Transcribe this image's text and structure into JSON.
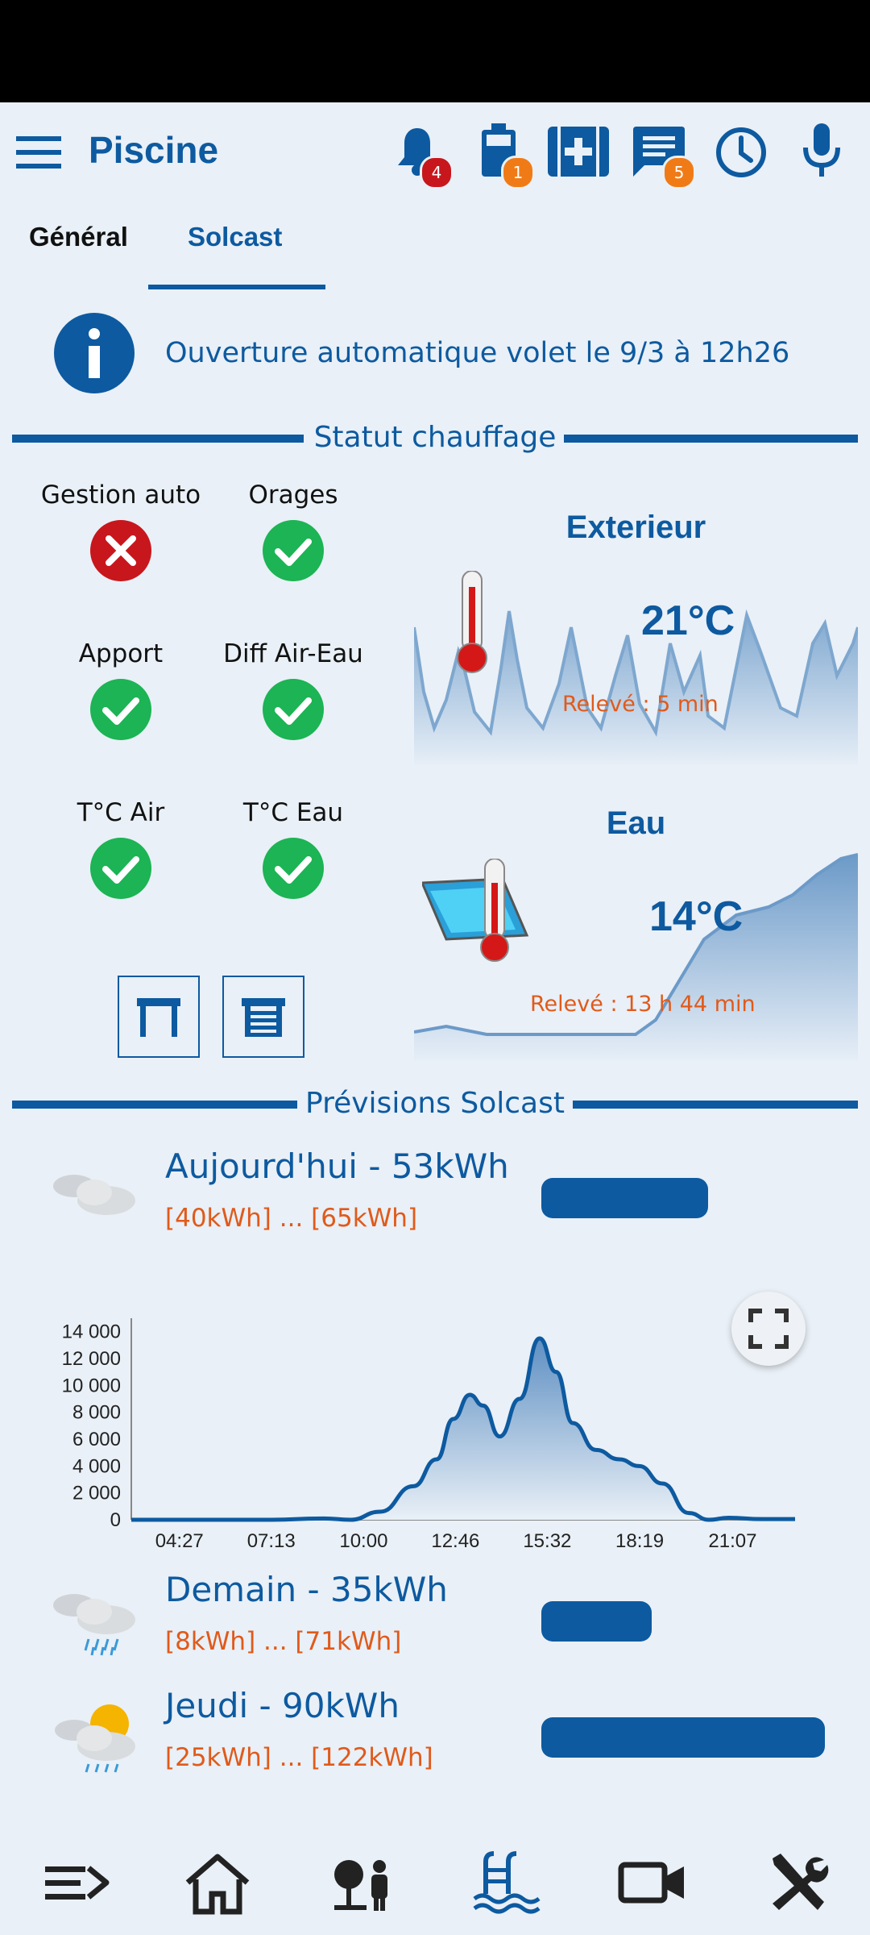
{
  "app": {
    "title": "Piscine"
  },
  "header": {
    "badges": {
      "notifications": "4",
      "battery": "1",
      "messages": "5"
    },
    "icons": [
      "menu-icon",
      "bell-icon",
      "battery-icon",
      "medical-icon",
      "message-icon",
      "clock-icon",
      "mic-icon"
    ]
  },
  "tabs": [
    {
      "label": "Général"
    },
    {
      "label": "Solcast"
    }
  ],
  "info": {
    "text": "Ouverture automatique volet le 9/3 à 12h26"
  },
  "status_section": {
    "title": "Statut chauffage",
    "items": [
      {
        "label": "Gestion auto",
        "state": "error"
      },
      {
        "label": "Orages",
        "state": "ok"
      },
      {
        "label": "Apport",
        "state": "ok"
      },
      {
        "label": "Diff Air-Eau",
        "state": "ok"
      },
      {
        "label": "T°C Air",
        "state": "ok"
      },
      {
        "label": "T°C Eau",
        "state": "ok"
      }
    ]
  },
  "exterieur": {
    "title": "Exterieur",
    "temp": "21°C",
    "releve": "Relevé : 5 min"
  },
  "eau": {
    "title": "Eau",
    "temp": "14°C",
    "releve": "Relevé : 13 h 44 min"
  },
  "forecast_section": {
    "title": "Prévisions Solcast",
    "days": [
      {
        "title": "Aujourd'hui - 53kWh",
        "range": "[40kWh] ... [65kWh]",
        "kwh": 53
      },
      {
        "title": "Demain - 35kWh",
        "range": "[8kWh] ... [71kWh]",
        "kwh": 35
      },
      {
        "title": "Jeudi - 90kWh",
        "range": "[25kWh] ... [122kWh]",
        "kwh": 90
      }
    ]
  },
  "chart_data": {
    "type": "area",
    "x_ticks": [
      "04:27",
      "07:13",
      "10:00",
      "12:46",
      "15:32",
      "18:19",
      "21:07"
    ],
    "y_ticks": [
      "14 000",
      "12 000",
      "10 000",
      "8 000",
      "6 000",
      "4 000",
      "2 000",
      "0"
    ],
    "ylim": [
      0,
      15000
    ],
    "x_hours": [
      3,
      4.45,
      7.22,
      8.8,
      9.6,
      10.5,
      11.5,
      12.2,
      12.7,
      13.2,
      13.6,
      14.1,
      14.7,
      15.3,
      15.8,
      16.3,
      17.0,
      17.7,
      18.3,
      19.0,
      19.8,
      20.4,
      21.0,
      22.0,
      23.0
    ],
    "values": [
      0,
      0,
      0,
      100,
      0,
      600,
      2500,
      4500,
      7500,
      9300,
      8500,
      6200,
      9000,
      13500,
      11000,
      7200,
      5200,
      4500,
      4000,
      2700,
      500,
      0,
      150,
      50,
      50
    ]
  },
  "colors": {
    "accent": "#0d5aa0",
    "orange": "#e05a1a",
    "ok": "#1cb454",
    "error": "#c8161d",
    "badge_red": "#c8161d",
    "badge_orange": "#f07b16"
  },
  "navbar": [
    "menu-list-icon",
    "home-icon",
    "garden-icon",
    "pool-icon",
    "camera-icon",
    "tools-icon"
  ]
}
